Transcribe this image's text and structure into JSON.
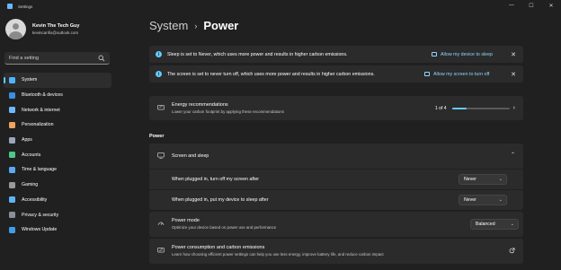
{
  "window": {
    "title": "Settings",
    "minimize": "—",
    "maximize": "☐",
    "close": "✕"
  },
  "profile": {
    "name": "Kevin The Tech Guy",
    "email": "kevincanfix@outlook.com"
  },
  "search": {
    "placeholder": "Find a setting"
  },
  "sidebar": {
    "items": [
      {
        "label": "System",
        "icon": "system-icon",
        "color": "#4fb3ff",
        "active": true
      },
      {
        "label": "Bluetooth & devices",
        "icon": "bluetooth-icon",
        "color": "#3b8fe0"
      },
      {
        "label": "Network & internet",
        "icon": "wifi-icon",
        "color": "#6fb7ff"
      },
      {
        "label": "Personalization",
        "icon": "brush-icon",
        "color": "#f0a35e"
      },
      {
        "label": "Apps",
        "icon": "apps-icon",
        "color": "#9aa7b8"
      },
      {
        "label": "Accounts",
        "icon": "account-icon",
        "color": "#4fc78b"
      },
      {
        "label": "Time & language",
        "icon": "globe-icon",
        "color": "#5aa8f0"
      },
      {
        "label": "Gaming",
        "icon": "gamepad-icon",
        "color": "#9a9a9a"
      },
      {
        "label": "Accessibility",
        "icon": "accessibility-icon",
        "color": "#5fb4f5"
      },
      {
        "label": "Privacy & security",
        "icon": "shield-icon",
        "color": "#8a8f99"
      },
      {
        "label": "Windows Update",
        "icon": "update-icon",
        "color": "#3f9ee8"
      }
    ]
  },
  "breadcrumb": {
    "parent": "System",
    "separator": "›",
    "current": "Power"
  },
  "notices": [
    {
      "text": "Sleep is set to Never, which uses more power and results in higher carbon emissions.",
      "action": "Allow my device to sleep"
    },
    {
      "text": "The screen is set to never turn off, which uses more power and results in higher carbon emissions.",
      "action": "Allow my screen to turn off"
    }
  ],
  "energy": {
    "title": "Energy recommendations",
    "subtitle": "Lower your carbon footprint by applying these recommendations",
    "progress_text": "1 of 4",
    "progress_fraction": 0.25
  },
  "power_section": {
    "label": "Power"
  },
  "screen_sleep": {
    "title": "Screen and sleep",
    "rows": [
      {
        "label": "When plugged in, turn off my screen after",
        "value": "Never"
      },
      {
        "label": "When plugged in, put my device to sleep after",
        "value": "Never"
      }
    ]
  },
  "power_mode": {
    "title": "Power mode",
    "subtitle": "Optimize your device based on power use and performance",
    "value": "Balanced"
  },
  "consumption": {
    "title": "Power consumption and carbon emissions",
    "subtitle": "Learn how choosing efficient power settings can help you use less energy, improve battery life, and reduce carbon impact"
  },
  "colors": {
    "accent": "#60cdff",
    "background": "#202020",
    "card": "#2b2b2b"
  }
}
